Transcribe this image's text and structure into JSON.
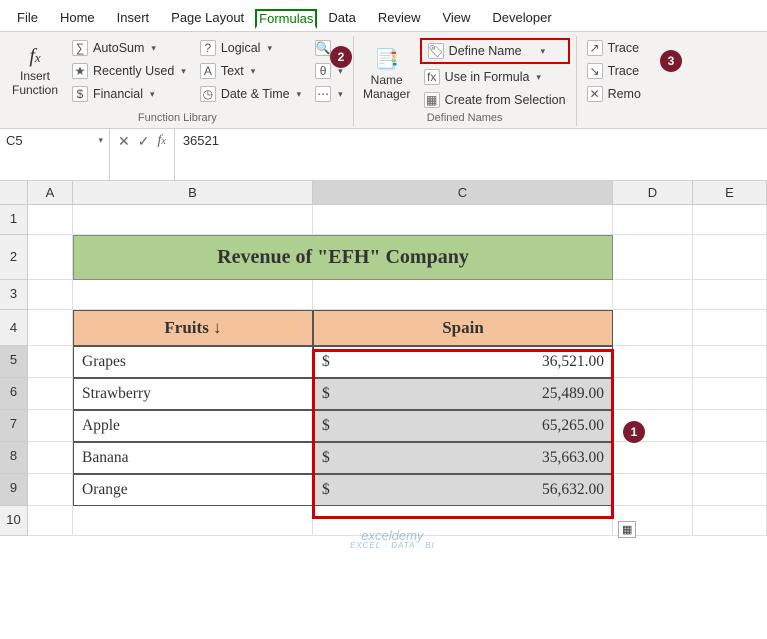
{
  "tabs": {
    "file": "File",
    "home": "Home",
    "insert": "Insert",
    "pagelayout": "Page Layout",
    "formulas": "Formulas",
    "data": "Data",
    "review": "Review",
    "view": "View",
    "developer": "Developer"
  },
  "ribbon": {
    "insertfn": "Insert Function",
    "autosum": "AutoSum",
    "recent": "Recently Used",
    "financial": "Financial",
    "logical": "Logical",
    "text": "Text",
    "datetime": "Date & Time",
    "group_fl": "Function Library",
    "namemgr": "Name Manager",
    "definename": "Define Name",
    "useinformula": "Use in Formula",
    "createfrom": "Create from Selection",
    "group_dn": "Defined Names",
    "trace1": "Trace",
    "trace2": "Trace",
    "remo": "Remo"
  },
  "fbar": {
    "ref": "C5",
    "val": "36521"
  },
  "cols": {
    "a": "A",
    "b": "B",
    "c": "C",
    "d": "D",
    "e": "E"
  },
  "rows": [
    "1",
    "2",
    "3",
    "4",
    "5",
    "6",
    "7",
    "8",
    "9",
    "10"
  ],
  "title": "Revenue of \"EFH\" Company",
  "headers": {
    "fruits": "Fruits ↓",
    "spain": "Spain"
  },
  "data": {
    "r5f": "Grapes",
    "r5s": "$",
    "r5v": "36,521.00",
    "r6f": "Strawberry",
    "r6s": "$",
    "r6v": "25,489.00",
    "r7f": "Apple",
    "r7s": "$",
    "r7v": "65,265.00",
    "r8f": "Banana",
    "r8s": "$",
    "r8v": "35,663.00",
    "r9f": "Orange",
    "r9s": "$",
    "r9v": "56,632.00"
  },
  "badges": {
    "b1": "1",
    "b2": "2",
    "b3": "3"
  },
  "wm": {
    "t": "exceldemy",
    "b": "EXCEL · DATA · BI"
  },
  "chart_data": {
    "type": "table",
    "title": "Revenue of \"EFH\" Company",
    "columns": [
      "Fruits",
      "Spain"
    ],
    "rows": [
      [
        "Grapes",
        36521.0
      ],
      [
        "Strawberry",
        25489.0
      ],
      [
        "Apple",
        65265.0
      ],
      [
        "Banana",
        35663.0
      ],
      [
        "Orange",
        56632.0
      ]
    ],
    "currency": "$"
  }
}
